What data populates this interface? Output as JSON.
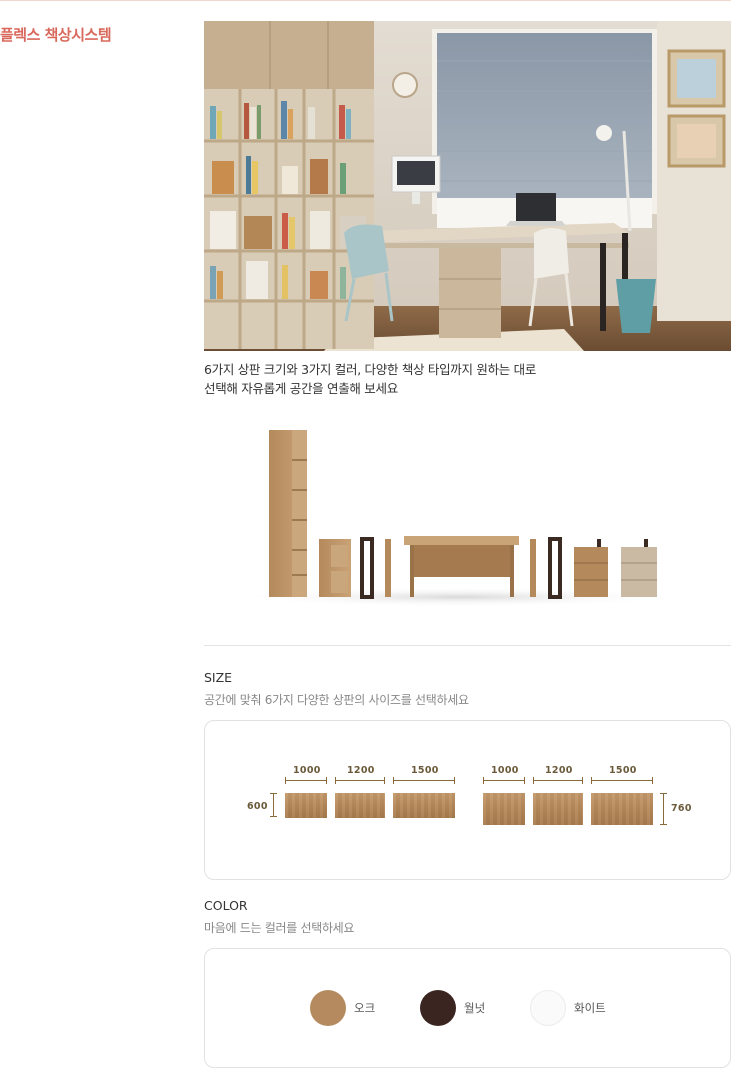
{
  "section": {
    "title": "플렉스 책상시스템"
  },
  "intro": {
    "line1": "6가지 상판 크기와 3가지 컬러, 다양한 책상 타입까지 원하는 대로",
    "line2": "선택해 자유롭게 공간을 연출해 보세요"
  },
  "size": {
    "heading": "SIZE",
    "subheading": "공간에 맞춰 6가지 다양한 상판의 사이즈를 선택하세요",
    "depth_a": "600",
    "depth_b": "760",
    "widths_a": [
      "1000",
      "1200",
      "1500"
    ],
    "widths_b": [
      "1000",
      "1200",
      "1500"
    ]
  },
  "color": {
    "heading": "COLOR",
    "subheading": "마음에 드는 컬러를 선택하세요",
    "options": [
      {
        "label": "오크",
        "hex": "#b48a5e"
      },
      {
        "label": "월넛",
        "hex": "#3b2520"
      },
      {
        "label": "화이트",
        "hex": "#fafafa"
      }
    ]
  }
}
